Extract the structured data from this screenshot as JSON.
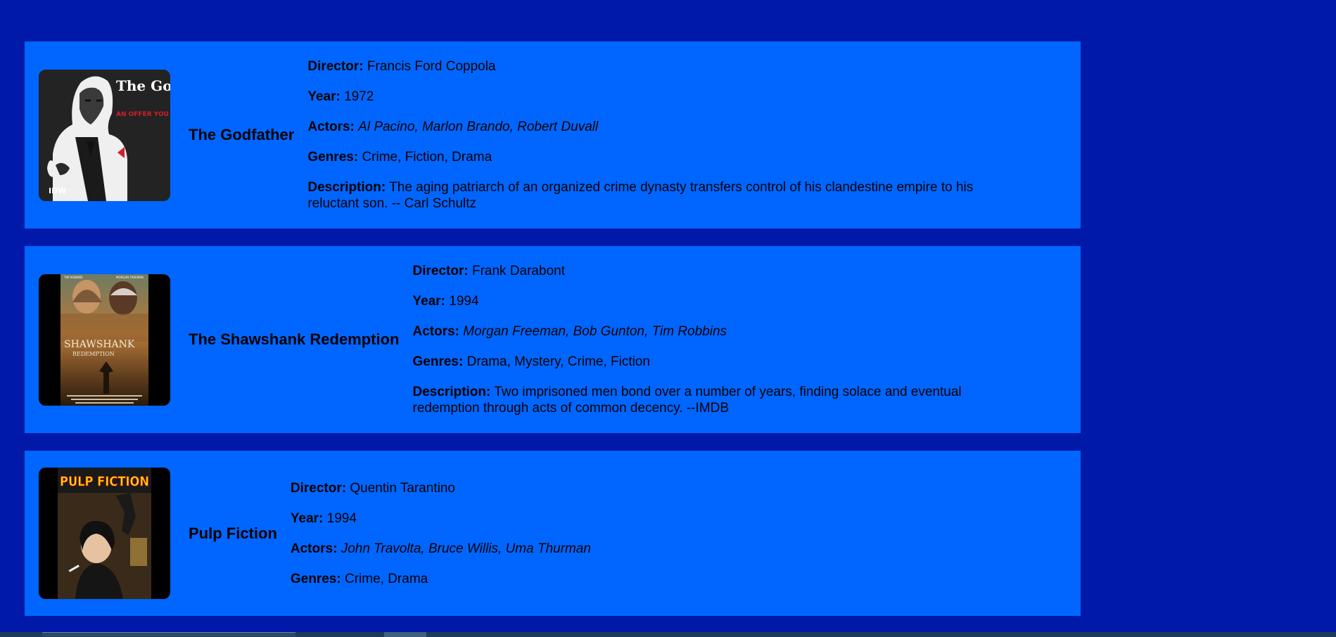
{
  "labels": {
    "director": "Director:",
    "year": "Year:",
    "actors": "Actors:",
    "genres": "Genres:",
    "description": "Description:"
  },
  "movies": [
    {
      "title": "The Godfather",
      "director": "Francis Ford Coppola",
      "year": "1972",
      "actors": "Al Pacino, Marlon Brando, Robert Duvall",
      "genres": "Crime, Fiction, Drama",
      "description": "The aging patriarch of an organized crime dynasty transfers control of his clandestine empire to his reluctant son. -- Carl Schultz",
      "poster": {
        "title_text": "The Godfather",
        "tagline": "AN OFFER YOU CAN'T REFUSE",
        "publisher": "IDW"
      }
    },
    {
      "title": "The Shawshank Redemption",
      "director": "Frank Darabont",
      "year": "1994",
      "actors": "Morgan Freeman, Bob Gunton, Tim Robbins",
      "genres": "Drama, Mystery, Crime, Fiction",
      "description": "Two imprisoned men bond over a number of years, finding solace and eventual redemption through acts of common decency. --IMDB",
      "poster": {
        "title_text": "SHAWSHANK",
        "subtitle": "REDEMPTION",
        "credit_left": "TIM ROBBINS",
        "credit_right": "MORGAN FREEMAN"
      }
    },
    {
      "title": "Pulp Fiction",
      "director": "Quentin Tarantino",
      "year": "1994",
      "actors": "John Travolta, Bruce Willis, Uma Thurman",
      "genres": "Crime, Drama",
      "poster": {
        "title_text": "PULP FICTION"
      }
    }
  ],
  "colors": {
    "page_background": "#0019a8",
    "card_background": "#0066ff",
    "godfather_red": "#d21f2d",
    "pulp_yellow": "#ffd400"
  }
}
